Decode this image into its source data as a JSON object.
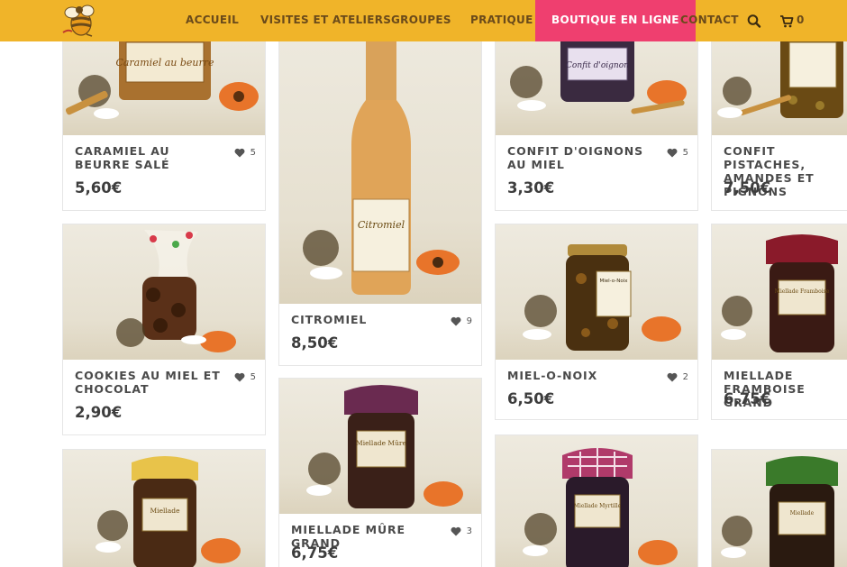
{
  "nav": {
    "items": [
      "ACCUEIL",
      "VISITES ET ATELIERS",
      "GROUPES",
      "PRATIQUE",
      "BOUTIQUE EN LIGNE",
      "CONTACT"
    ],
    "active": "BOUTIQUE EN LIGNE",
    "cart_count": "0"
  },
  "colors": {
    "header": "#f0b429",
    "active_tab": "#ef3f6f",
    "text": "#3a3a3a"
  },
  "icons": {
    "search": "search-icon",
    "cart": "cart-icon",
    "like": "heart-icon",
    "logo": "bee-logo"
  },
  "products": [
    {
      "name": "CARAMIEL AU BEURRE SALÉ",
      "price": "5,60€",
      "likes": "5",
      "label": "Caramiel au beurre"
    },
    {
      "name": "CITROMIEL",
      "price": "8,50€",
      "likes": "9",
      "label": "Citromiel"
    },
    {
      "name": "CONFIT D'OIGNONS AU MIEL",
      "price": "3,30€",
      "likes": "5",
      "label": "Confit d'oignon"
    },
    {
      "name": "CONFIT PISTACHES, AMANDES ET PIGNONS",
      "price": "7,50€",
      "likes": "",
      "label": ""
    },
    {
      "name": "COOKIES AU MIEL ET CHOCOLAT",
      "price": "2,90€",
      "likes": "5",
      "label": ""
    },
    {
      "name": "MIEL-O-NOIX",
      "price": "6,50€",
      "likes": "2",
      "label": "Miel-o-Noix"
    },
    {
      "name": "MIELLADE FRAMBOISE GRAND",
      "price": "6,75€",
      "likes": "",
      "label": "Miellade Framboise"
    },
    {
      "name": "MIELLADE MÛRE GRAND",
      "price": "6,75€",
      "likes": "3",
      "label": "Miellade Mûre"
    },
    {
      "name": "",
      "price": "",
      "likes": "",
      "label": "Miellade"
    },
    {
      "name": "",
      "price": "",
      "likes": "",
      "label": "Miellade Myrtille"
    },
    {
      "name": "",
      "price": "",
      "likes": "",
      "label": "Miellade"
    }
  ]
}
